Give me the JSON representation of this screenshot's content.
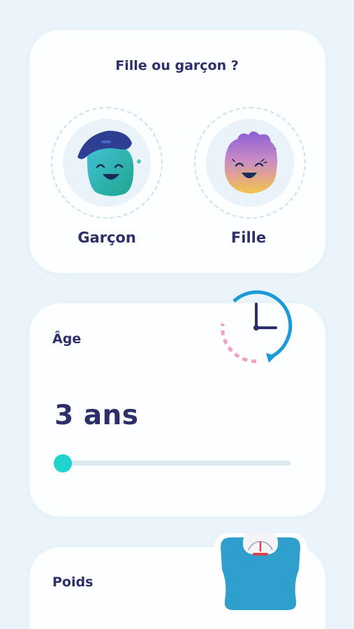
{
  "gender": {
    "title": "Fille ou garçon ?",
    "options": [
      {
        "label": "Garçon",
        "icon": "boy-avatar-icon"
      },
      {
        "label": "Fille",
        "icon": "girl-avatar-icon"
      }
    ]
  },
  "age": {
    "title": "Âge",
    "value": "3 ans",
    "slider_fraction": 0.0,
    "icon": "clock-icon"
  },
  "weight": {
    "title": "Poids",
    "icon": "scale-icon"
  },
  "colors": {
    "background": "#eaf4fa",
    "card": "#fdfeff",
    "text": "#2d2f6b",
    "accent": "#1fd3cf",
    "track": "#d9e9ef"
  }
}
